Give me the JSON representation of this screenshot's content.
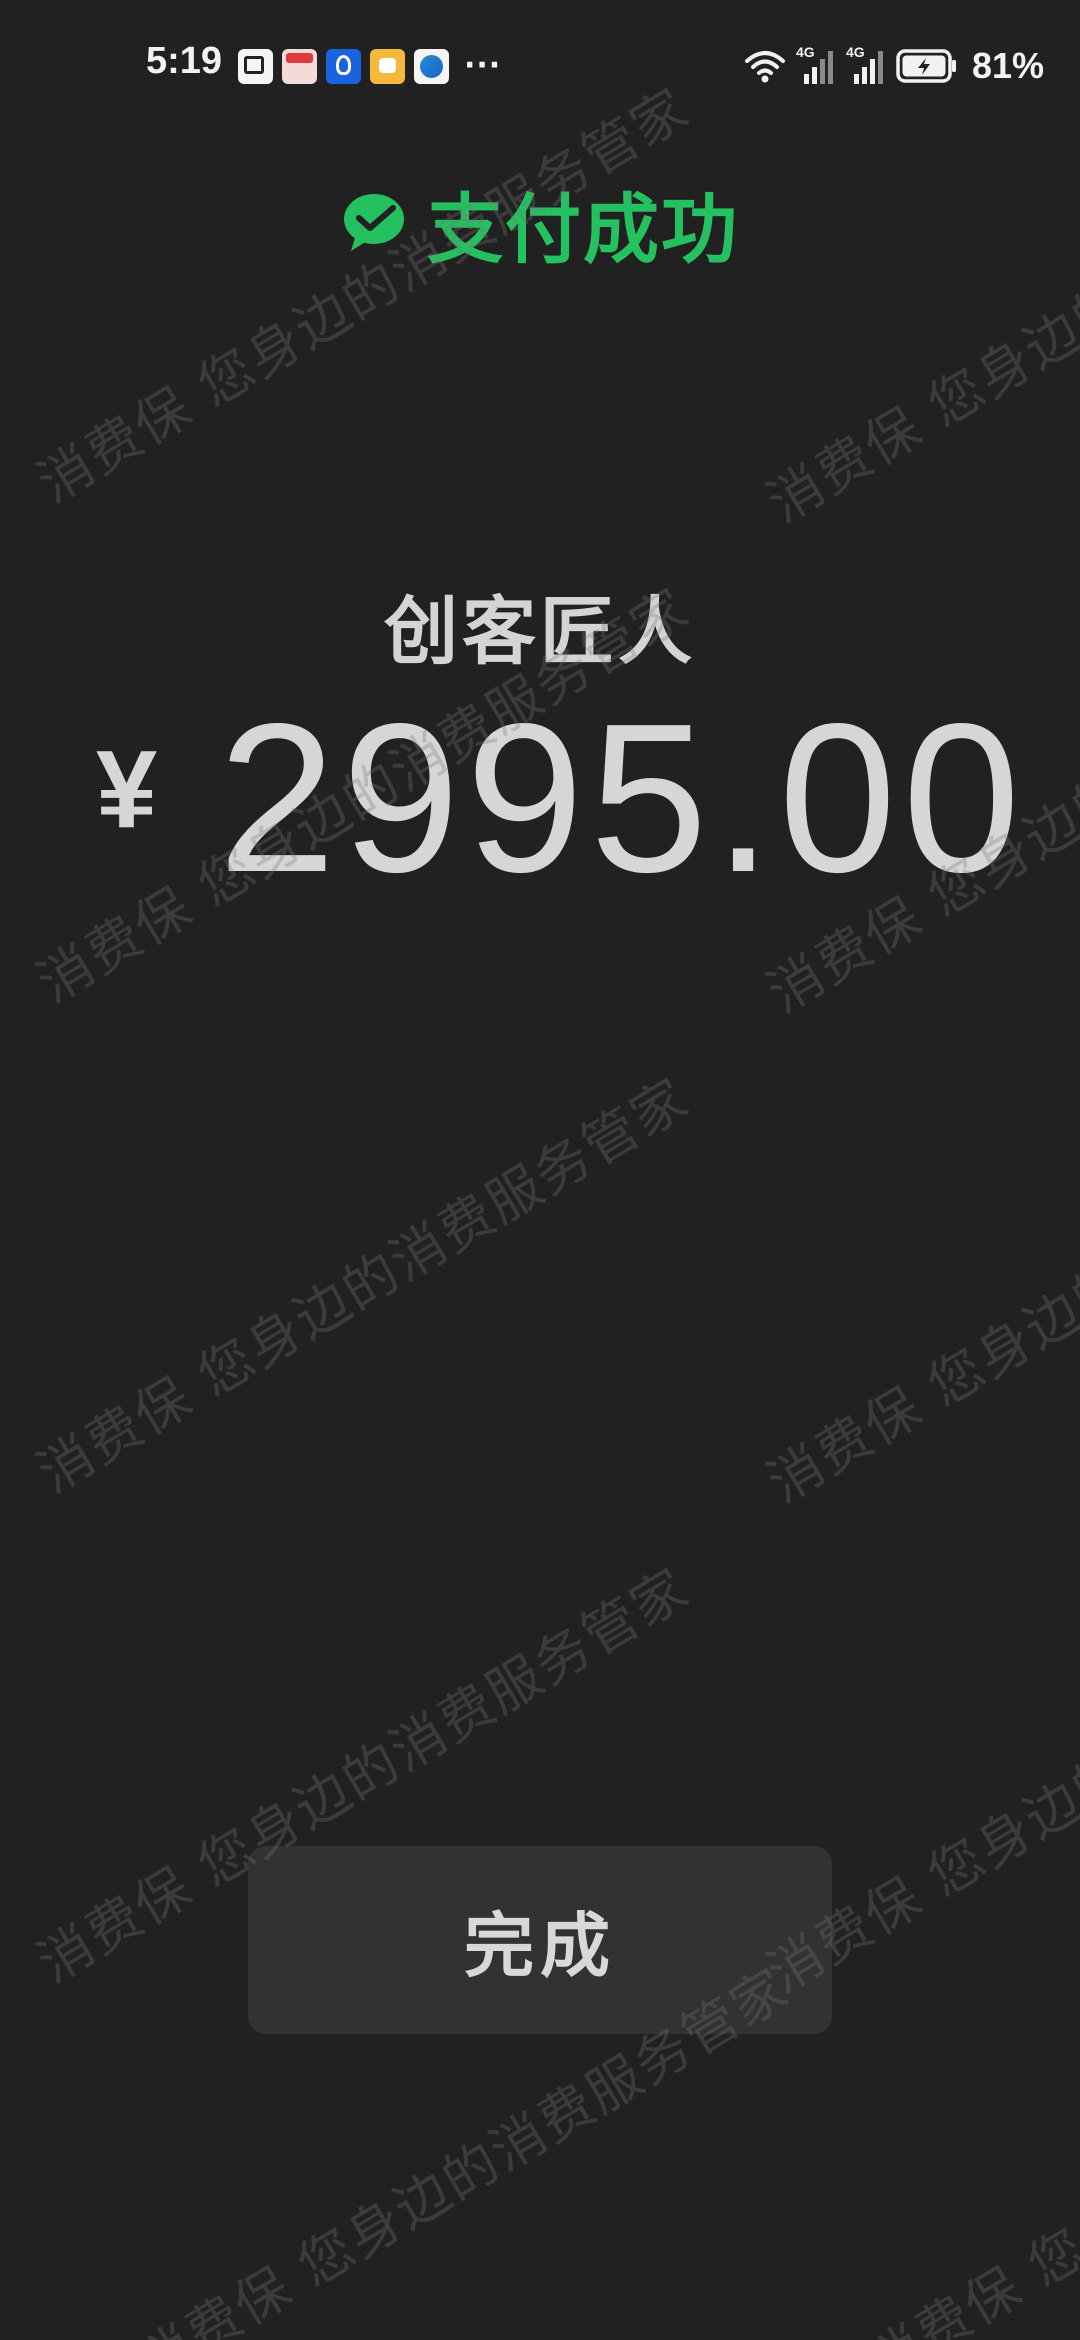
{
  "status_bar": {
    "time": "5:19",
    "more": "···",
    "network_1": "4G",
    "network_2": "4G",
    "battery_level": 81,
    "battery": "81%",
    "notification_icons": [
      "gallery-alert-icon",
      "box-app-icon",
      "bulb-app-icon",
      "message-app-icon",
      "browser-app-icon"
    ]
  },
  "header": {
    "title": "支付成功",
    "icon": "wechat-pay-check-icon",
    "accent_color": "#25c05f"
  },
  "payment": {
    "merchant": "创客匠人",
    "currency_symbol": "¥",
    "amount": "2995.00"
  },
  "done_button": {
    "label": "完成"
  },
  "watermark": {
    "text": "消费保 您身边的消费服务管家"
  }
}
